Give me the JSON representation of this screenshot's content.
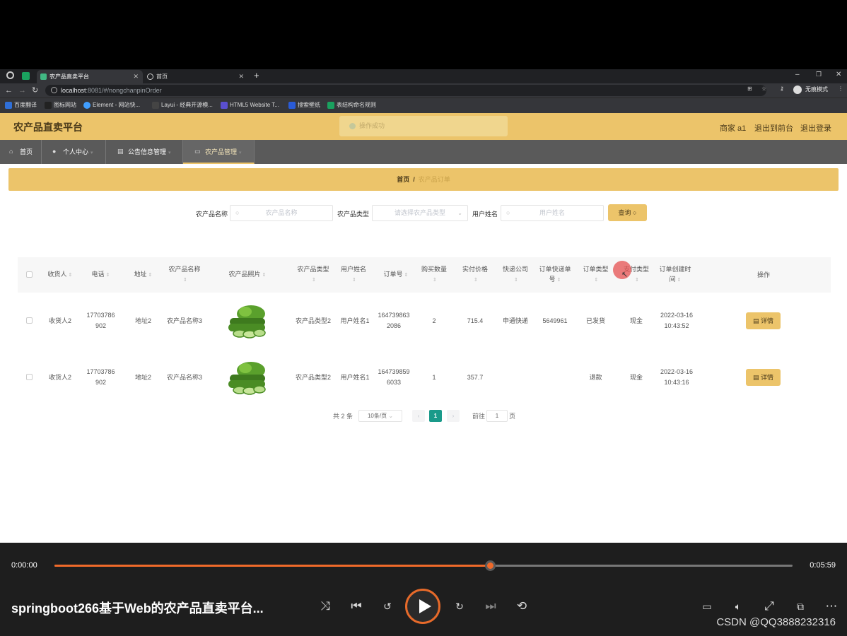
{
  "browser": {
    "tabs": [
      {
        "label": "农产品直卖平台",
        "active": true
      },
      {
        "label": "首页",
        "active": false
      }
    ],
    "new_tab": "+",
    "url_host": "localhost",
    "url_path": ":8081/#/nongchanpinOrder",
    "bookmarks": [
      "百度翻译",
      "图标网站",
      "Element - 网站快...",
      "Layui - 经典开源模...",
      "HTML5 Website T...",
      "搜索壁纸",
      "表结构命名规则"
    ],
    "profile_label": "无痕模式"
  },
  "header": {
    "title": "农产品直卖平台",
    "toast": "操作成功",
    "user": "商家 a1",
    "front_link": "退出到前台",
    "logout_link": "退出登录"
  },
  "nav": {
    "items": [
      {
        "label": "首页"
      },
      {
        "label": "个人中心"
      },
      {
        "label": "公告信息管理"
      },
      {
        "label": "农产品管理"
      }
    ]
  },
  "breadcrumb": {
    "home": "首页",
    "separator": "/",
    "current": "农产品订单"
  },
  "search": {
    "name_label": "农产品名称",
    "name_placeholder": "农产品名称",
    "type_label": "农产品类型",
    "type_placeholder": "请选择农产品类型",
    "user_label": "用户姓名",
    "user_placeholder": "用户姓名",
    "button": "查询"
  },
  "table": {
    "headers": [
      "收货人",
      "电话",
      "地址",
      "农产品名称",
      "农产品照片",
      "农产品类型",
      "用户姓名",
      "订单号",
      "购买数量",
      "实付价格",
      "快递公司",
      "订单快递单号",
      "订单类型",
      "支付类型",
      "订单创建时间",
      "操作"
    ],
    "rows": [
      {
        "receiver": "收货人2",
        "phone": "17703786902",
        "address": "地址2",
        "product_name": "农产品名称3",
        "product_type": "农产品类型2",
        "user_name": "用户姓名1",
        "order_no": "1647398632086",
        "quantity": "2",
        "price": "715.4",
        "courier": "申通快递",
        "tracking_no": "5649961",
        "order_type": "已发货",
        "pay_type": "现金",
        "created": "2022-03-16 10:43:52",
        "action": "详情"
      },
      {
        "receiver": "收货人2",
        "phone": "17703786902",
        "address": "地址2",
        "product_name": "农产品名称3",
        "product_type": "农产品类型2",
        "user_name": "用户姓名1",
        "order_no": "1647398596033",
        "quantity": "1",
        "price": "357.7",
        "courier": "",
        "tracking_no": "",
        "order_type": "退款",
        "pay_type": "现金",
        "created": "2022-03-16 10:43:16",
        "action": "详情"
      }
    ]
  },
  "pagination": {
    "total": "共 2 条",
    "page_size": "10条/页",
    "current_page": "1",
    "goto_label": "前往",
    "goto_value": "1",
    "page_suffix": "页"
  },
  "player": {
    "time_current": "0:00:00",
    "time_total": "0:05:59",
    "progress": 0.59,
    "title": "springboot266基于Web的农产品直卖平台...",
    "watermark": "CSDN @QQ3888232316"
  }
}
